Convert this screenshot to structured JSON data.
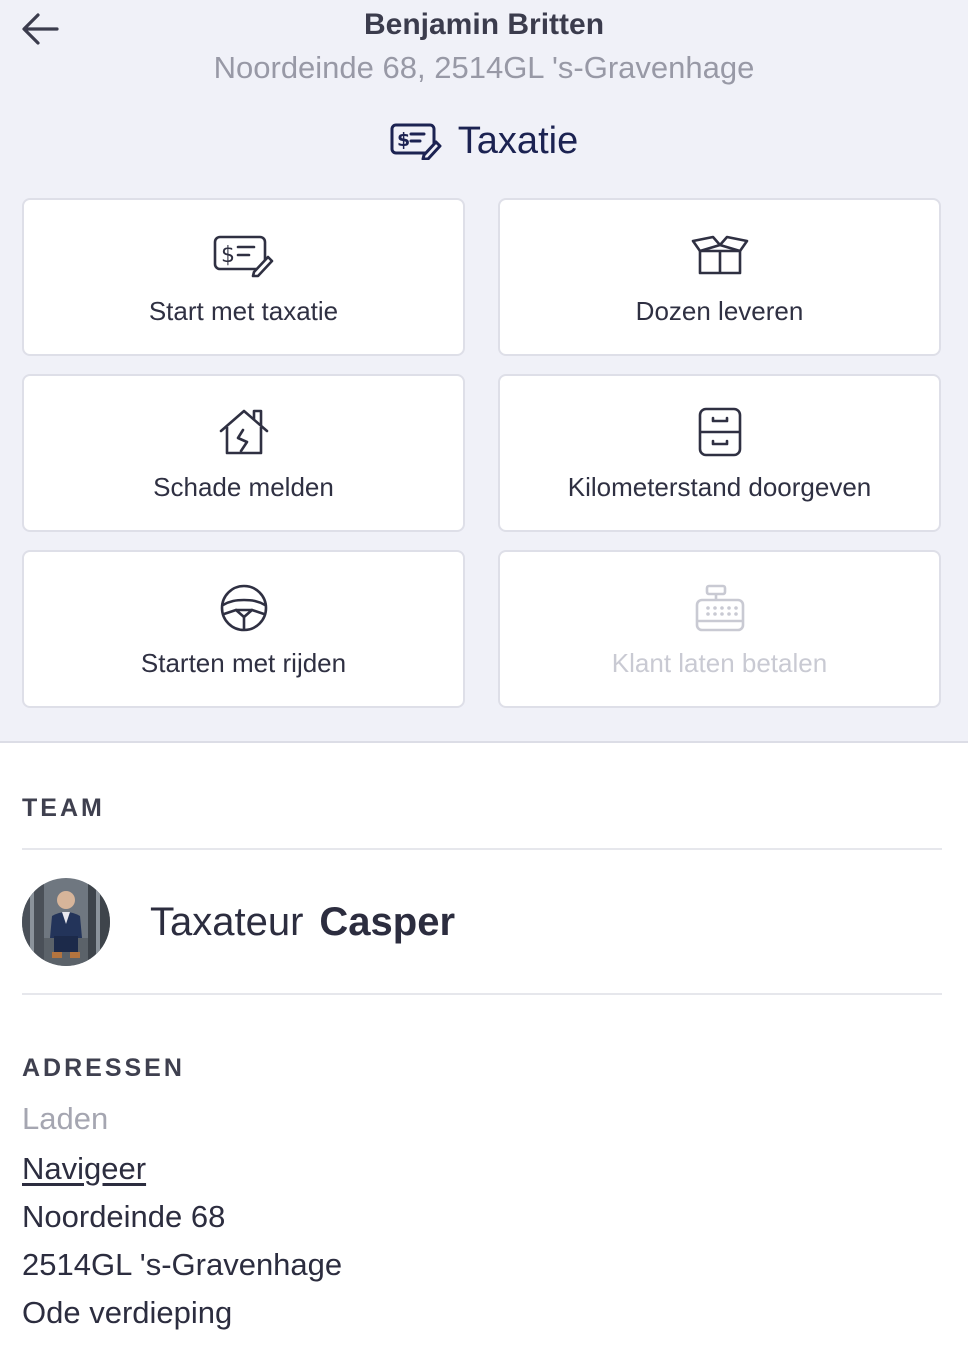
{
  "header": {
    "back_icon": "arrow-left-icon",
    "name": "Benjamin Britten",
    "address": "Noordeinde 68, 2514GL 's-Gravenhage"
  },
  "section": {
    "icon": "receipt-pen-icon",
    "title": "Taxatie"
  },
  "actions": [
    {
      "label": "Start met taxatie",
      "icon": "receipt-pen-icon",
      "enabled": true
    },
    {
      "label": "Dozen leveren",
      "icon": "open-box-icon",
      "enabled": true
    },
    {
      "label": "Schade melden",
      "icon": "broken-house-icon",
      "enabled": true
    },
    {
      "label": "Kilometerstand doorgeven",
      "icon": "odometer-cabinet-icon",
      "enabled": true
    },
    {
      "label": "Starten met rijden",
      "icon": "steering-wheel-icon",
      "enabled": true
    },
    {
      "label": "Klant laten betalen",
      "icon": "cash-register-icon",
      "enabled": false
    }
  ],
  "team": {
    "heading": "TEAM",
    "members": [
      {
        "role": "Taxateur",
        "name": "Casper",
        "avatar": "avatar-photo"
      }
    ]
  },
  "addresses": {
    "heading": "ADRESSEN",
    "items": [
      {
        "type": "Laden",
        "navigate_label": "Navigeer",
        "street": "Noordeinde 68",
        "city": "2514GL 's-Gravenhage",
        "floor": "Ode verdieping"
      }
    ]
  },
  "colors": {
    "background_top": "#f0f1f8",
    "title_color": "#1c2352",
    "text": "#2c2d3f",
    "muted": "#9899a6",
    "disabled": "#c9cad3"
  }
}
